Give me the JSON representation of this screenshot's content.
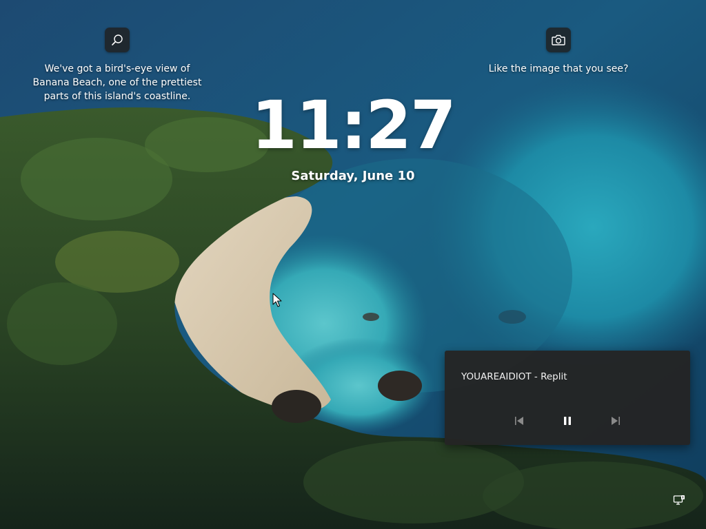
{
  "lockscreen": {
    "info_hotspot": {
      "icon": "search-icon",
      "text": "We've got a bird's-eye view of Banana Beach, one of the prettiest parts of this island's coastline."
    },
    "camera_hotspot": {
      "icon": "camera-icon",
      "text": "Like the image that you see?"
    },
    "clock": {
      "time": "11:27",
      "date": "Saturday, June 10"
    },
    "media": {
      "title": "YOUAREAIDIOT - Replit",
      "controls": {
        "previous": "previous-track-icon",
        "pause": "pause-icon",
        "next": "next-track-icon"
      }
    },
    "status": {
      "network_icon": "network-icon"
    }
  },
  "colors": {
    "sea_deep": "#17486e",
    "sea_teal": "#1c8ca8",
    "lagoon": "#3fb2c0",
    "sand": "#d9cbb2",
    "forest": "#24391f",
    "panel": "#242424"
  }
}
